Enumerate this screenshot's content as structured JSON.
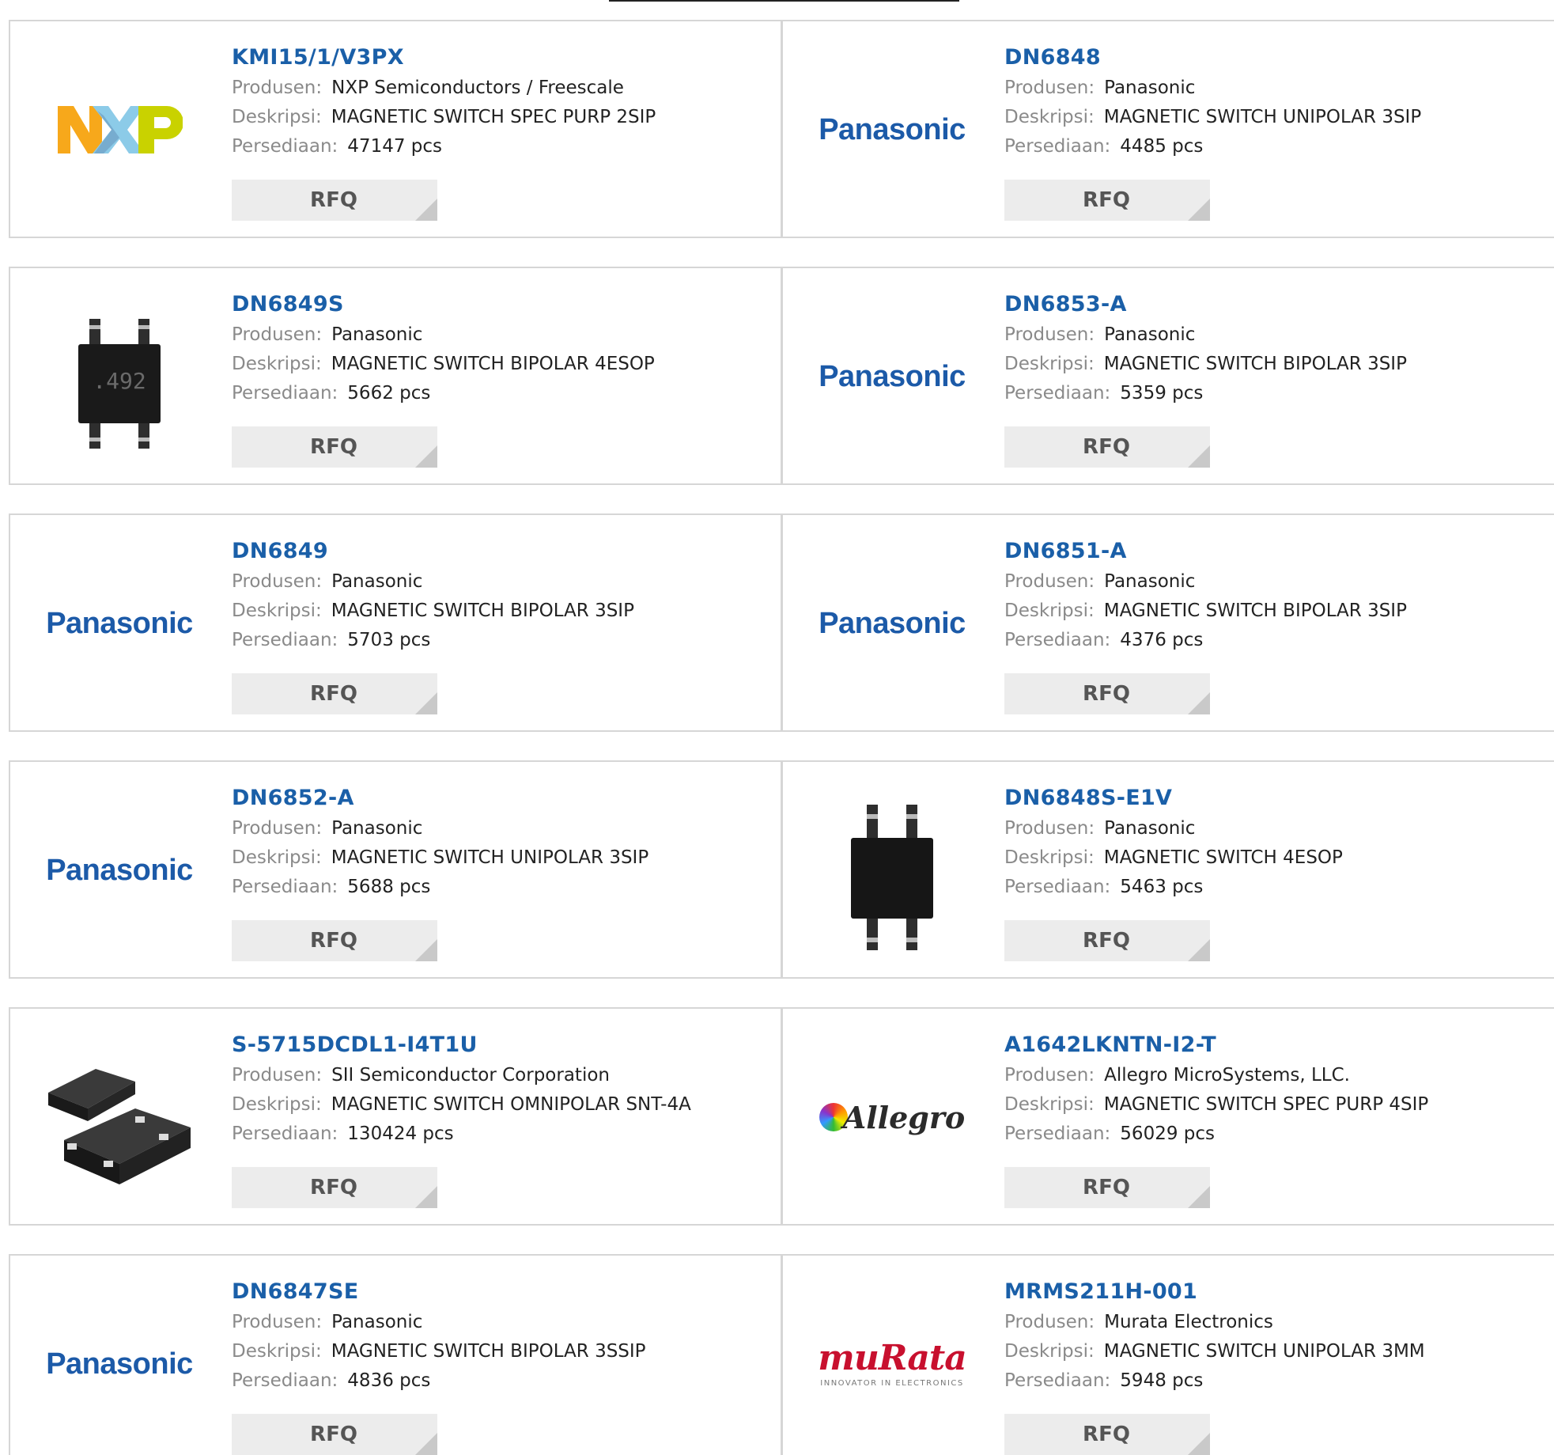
{
  "labels": {
    "produsen": "Produsen:",
    "deskripsi": "Deskripsi:",
    "persediaan": "Persediaan:",
    "rfq": "RFQ"
  },
  "products": [
    {
      "part": "KMI15/1/V3PX",
      "manufacturer": "NXP Semiconductors / Freescale",
      "description": "MAGNETIC SWITCH SPEC PURP 2SIP",
      "stock": "47147 pcs",
      "logo": "nxp-logo"
    },
    {
      "part": "DN6848",
      "manufacturer": "Panasonic",
      "description": "MAGNETIC SWITCH UNIPOLAR 3SIP",
      "stock": "4485 pcs",
      "logo": "panasonic-logo",
      "logo_text": "Panasonic"
    },
    {
      "part": "DN6849S",
      "manufacturer": "Panasonic",
      "description": "MAGNETIC SWITCH BIPOLAR 4ESOP",
      "stock": "5662 pcs",
      "logo": "chip-4esop-image",
      "chip_marking": ".492"
    },
    {
      "part": "DN6853-A",
      "manufacturer": "Panasonic",
      "description": "MAGNETIC SWITCH BIPOLAR 3SIP",
      "stock": "5359 pcs",
      "logo": "panasonic-logo",
      "logo_text": "Panasonic"
    },
    {
      "part": "DN6849",
      "manufacturer": "Panasonic",
      "description": "MAGNETIC SWITCH BIPOLAR 3SIP",
      "stock": "5703 pcs",
      "logo": "panasonic-logo",
      "logo_text": "Panasonic"
    },
    {
      "part": "DN6851-A",
      "manufacturer": "Panasonic",
      "description": "MAGNETIC SWITCH BIPOLAR 3SIP",
      "stock": "4376 pcs",
      "logo": "panasonic-logo",
      "logo_text": "Panasonic"
    },
    {
      "part": "DN6852-A",
      "manufacturer": "Panasonic",
      "description": "MAGNETIC SWITCH UNIPOLAR 3SIP",
      "stock": "5688 pcs",
      "logo": "panasonic-logo",
      "logo_text": "Panasonic"
    },
    {
      "part": "DN6848S-E1V",
      "manufacturer": "Panasonic",
      "description": "MAGNETIC SWITCH 4ESOP",
      "stock": "5463 pcs",
      "logo": "chip-4esop-image"
    },
    {
      "part": "S-5715DCDL1-I4T1U",
      "manufacturer": "SII Semiconductor Corporation",
      "description": "MAGNETIC SWITCH OMNIPOLAR SNT-4A",
      "stock": "130424 pcs",
      "logo": "chip-snt4a-image"
    },
    {
      "part": "A1642LKNTN-I2-T",
      "manufacturer": "Allegro MicroSystems, LLC.",
      "description": "MAGNETIC SWITCH SPEC PURP 4SIP",
      "stock": "56029 pcs",
      "logo": "allegro-logo",
      "logo_text": "Allegro"
    },
    {
      "part": "DN6847SE",
      "manufacturer": "Panasonic",
      "description": "MAGNETIC SWITCH BIPOLAR 3SSIP",
      "stock": "4836 pcs",
      "logo": "panasonic-logo",
      "logo_text": "Panasonic"
    },
    {
      "part": "MRMS211H-001",
      "manufacturer": "Murata Electronics",
      "description": "MAGNETIC SWITCH UNIPOLAR 3MM",
      "stock": "5948 pcs",
      "logo": "murata-logo",
      "logo_text": "muRata",
      "logo_tagline": "INNOVATOR IN ELECTRONICS"
    }
  ],
  "colors": {
    "part_link": "#1a5fa8",
    "label": "#8a8a8a",
    "panasonic": "#1c5aa8",
    "murata": "#c8102e",
    "rfq_bg": "#ececec"
  }
}
